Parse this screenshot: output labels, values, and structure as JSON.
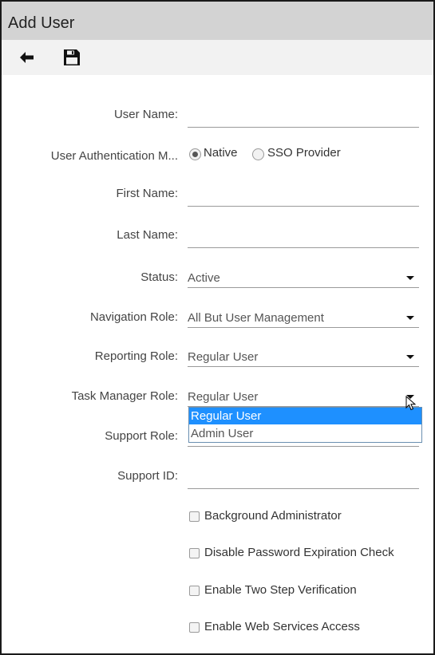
{
  "window": {
    "title": "Add User"
  },
  "toolbar": {
    "back": {
      "icon": "arrow-left-icon"
    },
    "save": {
      "icon": "floppy-disk-icon"
    }
  },
  "form": {
    "username": {
      "label": "User Name:",
      "value": ""
    },
    "auth": {
      "label": "User Authentication M...",
      "options": [
        "Native",
        "SSO Provider"
      ],
      "selected": "Native"
    },
    "firstname": {
      "label": "First Name:",
      "value": ""
    },
    "lastname": {
      "label": "Last Name:",
      "value": ""
    },
    "status": {
      "label": "Status:",
      "value": "Active"
    },
    "nav_role": {
      "label": "Navigation Role:",
      "value": "All But User Management"
    },
    "reporting_role": {
      "label": "Reporting Role:",
      "value": "Regular User"
    },
    "task_role": {
      "label": "Task Manager Role:",
      "value": "Regular User",
      "options": [
        "Regular User",
        "Admin User"
      ],
      "highlighted": "Regular User"
    },
    "support_role": {
      "label": "Support Role:",
      "value": ""
    },
    "support_id": {
      "label": "Support ID:",
      "value": ""
    },
    "checkboxes": [
      {
        "label": "Background Administrator",
        "checked": false
      },
      {
        "label": "Disable Password Expiration Check",
        "checked": false
      },
      {
        "label": "Enable Two Step Verification",
        "checked": false
      },
      {
        "label": "Enable Web Services Access",
        "checked": false
      }
    ]
  },
  "colors": {
    "highlight": "#1e90ff",
    "titlebar": "#d3d3d3"
  }
}
